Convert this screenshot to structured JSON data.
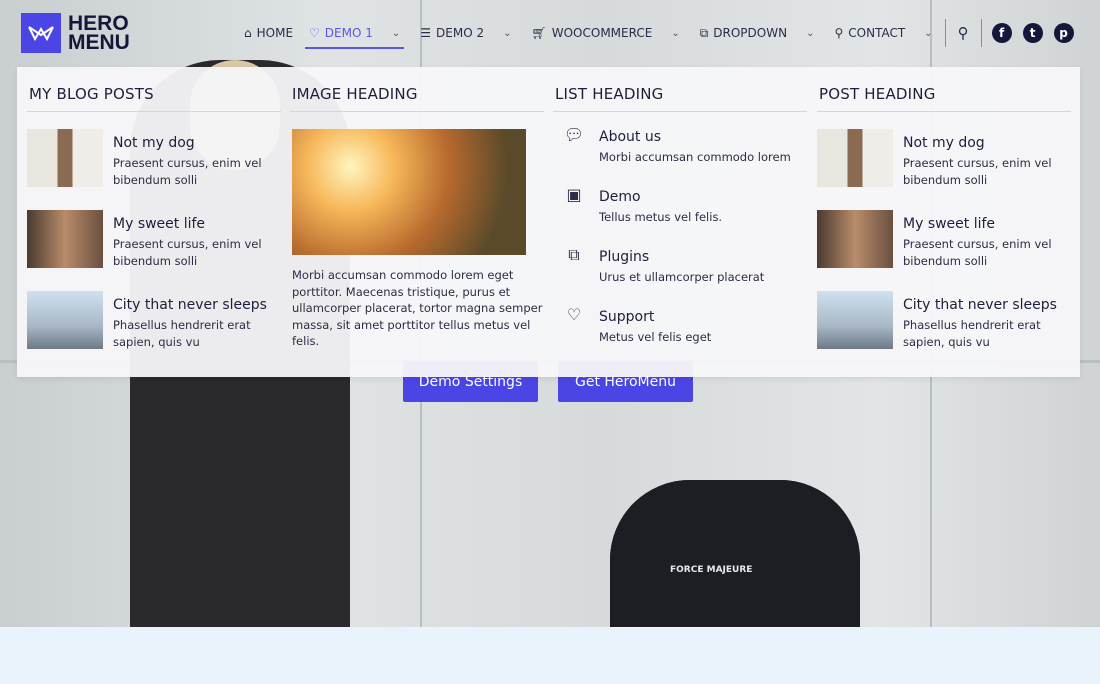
{
  "logo": {
    "line1": "HERO",
    "line2": "MENU"
  },
  "nav": {
    "items": [
      {
        "label": "HOME",
        "icon": "home-icon"
      },
      {
        "label": "DEMO 1",
        "icon": "heart-icon",
        "active": true,
        "dropdown": true
      },
      {
        "label": "DEMO 2",
        "icon": "list-icon",
        "dropdown": true
      },
      {
        "label": "WOOCOMMERCE",
        "icon": "cart-icon",
        "dropdown": true
      },
      {
        "label": "DROPDOWN",
        "icon": "puzzle-icon",
        "dropdown": true
      },
      {
        "label": "CONTACT",
        "icon": "map-pin-icon",
        "dropdown": true
      }
    ],
    "social": [
      "f",
      "t",
      "p"
    ]
  },
  "mega": {
    "blog": {
      "heading": "MY BLOG POSTS",
      "posts": [
        {
          "title": "Not my dog",
          "desc": "Praesent cursus, enim vel bibendum solli"
        },
        {
          "title": "My sweet life",
          "desc": "Praesent cursus, enim vel bibendum solli"
        },
        {
          "title": "City that never sleeps",
          "desc": "Phasellus hendrerit erat sapien, quis vu"
        }
      ]
    },
    "image": {
      "heading": "IMAGE HEADING",
      "text": "Morbi accumsan commodo lorem eget porttitor. Maecenas tristique, purus et ullamcorper placerat, tortor magna semper massa, sit amet porttitor tellus metus vel felis."
    },
    "list": {
      "heading": "LIST HEADING",
      "items": [
        {
          "title": "About us",
          "desc": "Morbi accumsan commodo lorem",
          "icon": "chat-icon"
        },
        {
          "title": "Demo",
          "desc": "Tellus metus vel felis.",
          "icon": "image-icon"
        },
        {
          "title": "Plugins",
          "desc": "Urus et ullamcorper placerat",
          "icon": "puzzle-icon"
        },
        {
          "title": "Support",
          "desc": "Metus vel felis eget",
          "icon": "heart-icon"
        }
      ]
    },
    "post": {
      "heading": "POST HEADING",
      "posts": [
        {
          "title": "Not my dog",
          "desc": "Praesent cursus, enim vel bibendum solli"
        },
        {
          "title": "My sweet life",
          "desc": "Praesent cursus, enim vel bibendum solli"
        },
        {
          "title": "City that never sleeps",
          "desc": "Phasellus hendrerit erat sapien, quis vu"
        }
      ]
    }
  },
  "hero": {
    "demo_settings": "Demo Settings",
    "get_heromenu": "Get HeroMenu",
    "shirt": "FORCE MAJEURE"
  },
  "colors": {
    "accent": "#4b45e6",
    "dark": "#15173a"
  }
}
